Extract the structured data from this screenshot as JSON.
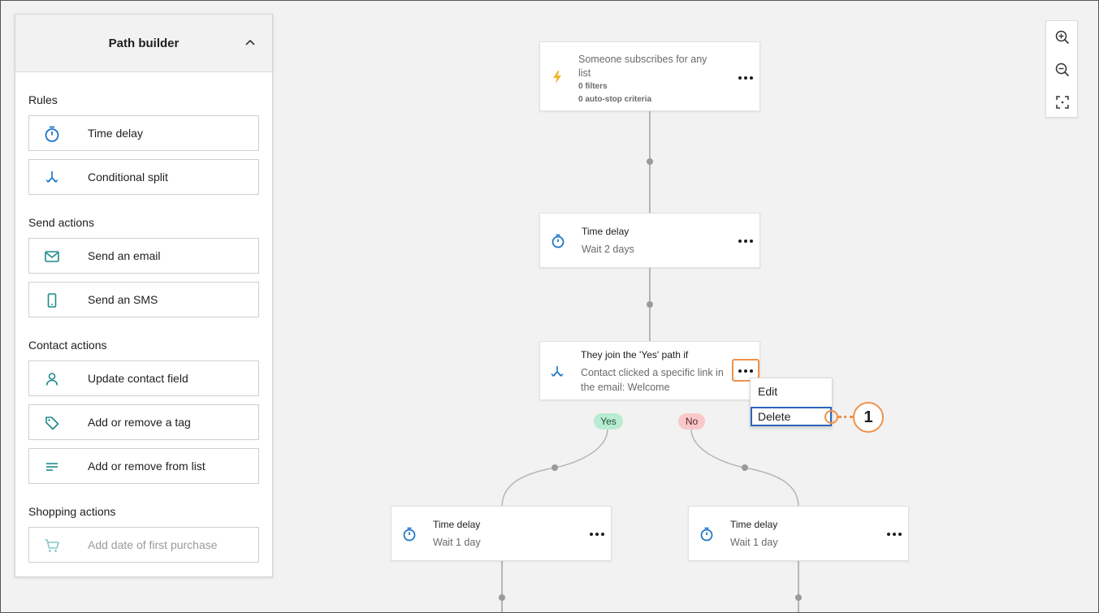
{
  "sidebar": {
    "title": "Path builder",
    "sections": {
      "rules": "Rules",
      "send_actions": "Send actions",
      "contact_actions": "Contact actions",
      "shopping_actions": "Shopping actions"
    },
    "items": {
      "time_delay": "Time delay",
      "conditional_split": "Conditional split",
      "send_email": "Send an email",
      "send_sms": "Send an SMS",
      "update_contact_field": "Update contact field",
      "add_remove_tag": "Add or remove a tag",
      "add_remove_list": "Add or remove from list",
      "add_first_purchase": "Add date of first purchase"
    }
  },
  "canvas": {
    "trigger": {
      "title_line1": "Someone subscribes for any",
      "title_line2": "list",
      "filters": "0 filters",
      "autostop": "0 auto-stop criteria"
    },
    "delay1": {
      "title": "Time delay",
      "sub": "Wait 2 days"
    },
    "split": {
      "title": "They join the 'Yes' path if",
      "sub_line1": "Contact clicked a specific link in",
      "sub_line2": "the email: Welcome"
    },
    "yes_label": "Yes",
    "no_label": "No",
    "delay_yes": {
      "title": "Time delay",
      "sub": "Wait 1 day"
    },
    "delay_no": {
      "title": "Time delay",
      "sub": "Wait 1 day"
    }
  },
  "menu": {
    "edit": "Edit",
    "delete": "Delete"
  },
  "callout": {
    "number": "1"
  },
  "colors": {
    "accent_icon": "#1a73c8",
    "teal_icon": "#1f8a8a",
    "trigger_icon": "#f2b531",
    "highlight": "#f0914a",
    "focus": "#2f64b8"
  }
}
